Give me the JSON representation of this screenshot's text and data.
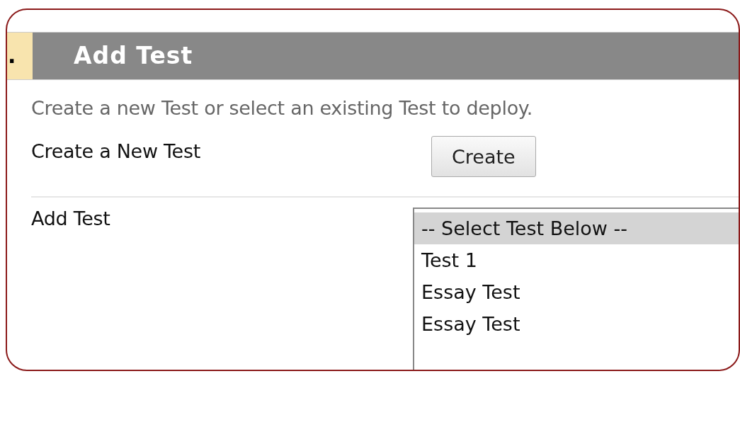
{
  "header": {
    "step": ".",
    "title": "Add Test"
  },
  "description": "Create a new Test or select an existing Test to deploy.",
  "create_row": {
    "label": "Create a New Test",
    "button": "Create"
  },
  "add_row": {
    "label": "Add Test",
    "options": [
      {
        "label": "-- Select Test Below --",
        "selected": true
      },
      {
        "label": "Test 1",
        "selected": false
      },
      {
        "label": "Essay Test",
        "selected": false
      },
      {
        "label": "Essay Test",
        "selected": false
      }
    ]
  }
}
